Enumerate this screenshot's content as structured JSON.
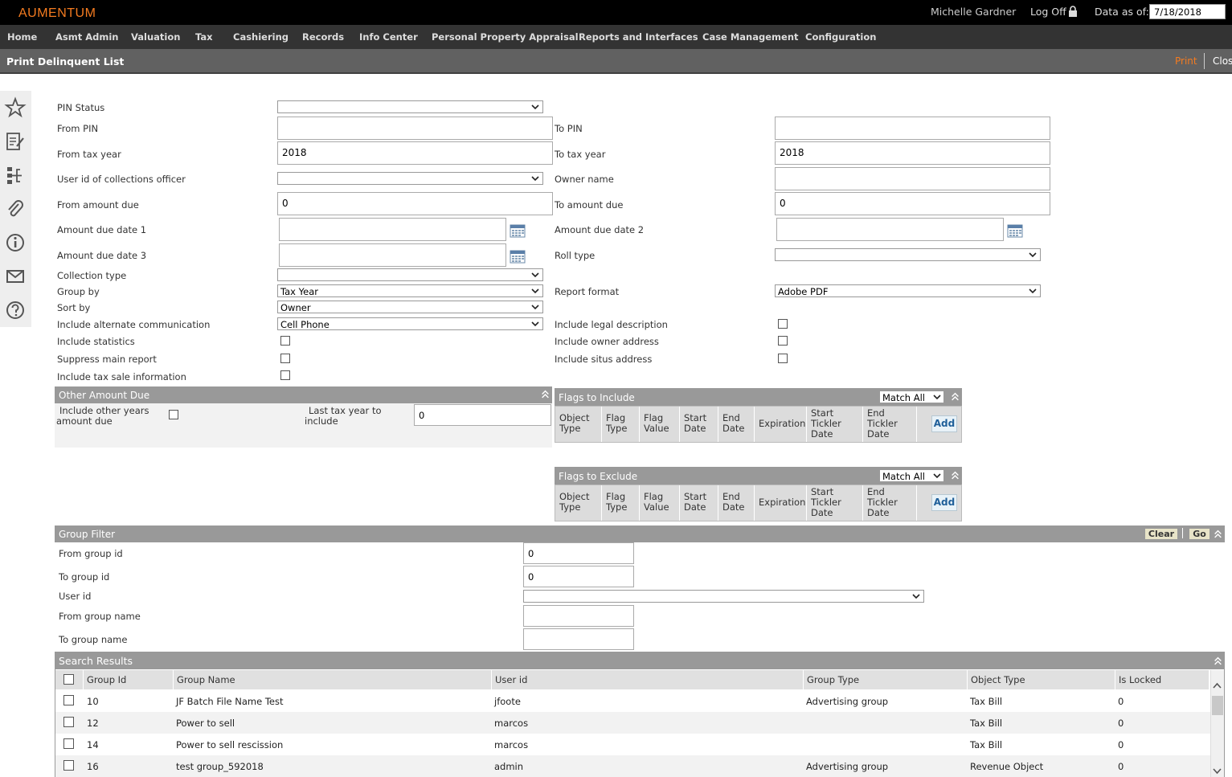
{
  "app": {
    "brand": "AUMENTUM",
    "user": "Michelle Gardner",
    "logoff": "Log Off",
    "data_as_of_label": "Data as of:",
    "data_as_of_value": "7/18/2018"
  },
  "nav": [
    "Home",
    "Asmt Admin",
    "Valuation",
    "Tax",
    "Cashiering",
    "Records",
    "Info Center",
    "Personal Property Appraisal",
    "Reports and Interfaces",
    "Case Management",
    "Configuration"
  ],
  "page": {
    "title": "Print Delinquent List",
    "print": "Print",
    "close": "Clos"
  },
  "form": {
    "pin_status": {
      "label": "PIN Status",
      "value": ""
    },
    "from_pin": {
      "label": "From PIN",
      "value": ""
    },
    "to_pin": {
      "label": "To PIN",
      "value": ""
    },
    "from_tax_year": {
      "label": "From tax year",
      "value": "2018"
    },
    "to_tax_year": {
      "label": "To tax year",
      "value": "2018"
    },
    "collections_officer": {
      "label": "User id of collections officer",
      "value": ""
    },
    "owner_name": {
      "label": "Owner name",
      "value": ""
    },
    "from_amount_due": {
      "label": "From amount due",
      "value": "0"
    },
    "to_amount_due": {
      "label": "To amount due",
      "value": "0"
    },
    "amount_due_date1": {
      "label": "Amount due date 1",
      "value": ""
    },
    "amount_due_date2": {
      "label": "Amount due date 2",
      "value": ""
    },
    "amount_due_date3": {
      "label": "Amount due date 3",
      "value": ""
    },
    "roll_type": {
      "label": "Roll type",
      "value": ""
    },
    "collection_type": {
      "label": "Collection type",
      "value": ""
    },
    "group_by": {
      "label": "Group by",
      "value": "Tax Year"
    },
    "report_format": {
      "label": "Report format",
      "value": "Adobe PDF"
    },
    "sort_by": {
      "label": "Sort by",
      "value": "Owner"
    },
    "alt_comm": {
      "label": "Include alternate communication",
      "value": "Cell Phone"
    },
    "legal_desc": {
      "label": "Include legal description"
    },
    "statistics": {
      "label": "Include statistics"
    },
    "owner_address": {
      "label": "Include owner address"
    },
    "suppress_main": {
      "label": "Suppress main report"
    },
    "situs_address": {
      "label": "Include situs address"
    },
    "tax_sale": {
      "label": "Include tax sale information"
    }
  },
  "other_amount": {
    "title": "Other Amount Due",
    "other_years_label_1": "Include other years",
    "other_years_label_2": "amount due",
    "last_tax_year_label_1": "Last tax year to",
    "last_tax_year_label_2": "include",
    "last_tax_year_value": "0"
  },
  "flags_include": {
    "title": "Flags to Include",
    "match": "Match All",
    "add": "Add"
  },
  "flags_exclude": {
    "title": "Flags to Exclude",
    "match": "Match All",
    "add": "Add"
  },
  "flag_columns": [
    [
      "Object",
      "Type"
    ],
    [
      "Flag",
      "Type"
    ],
    [
      "Flag",
      "Value"
    ],
    [
      "Start",
      "Date"
    ],
    [
      "End",
      "Date"
    ],
    [
      "Expiration"
    ],
    [
      "Start",
      "Tickler",
      "Date"
    ],
    [
      "End",
      "Tickler",
      "Date"
    ]
  ],
  "group_filter": {
    "title": "Group Filter",
    "clear": "Clear",
    "go": "Go",
    "from_group_id": {
      "label": "From group id",
      "value": "0"
    },
    "to_group_id": {
      "label": "To group id",
      "value": "0"
    },
    "user_id": {
      "label": "User id",
      "value": ""
    },
    "from_group_name": {
      "label": "From group name",
      "value": ""
    },
    "to_group_name": {
      "label": "To group name",
      "value": ""
    }
  },
  "search_results": {
    "title": "Search Results",
    "columns": [
      "Group Id",
      "Group Name",
      "User id",
      "Group Type",
      "Object Type",
      "Is Locked"
    ],
    "rows": [
      [
        "10",
        "JF Batch File Name Test",
        "jfoote",
        "Advertising group",
        "Tax Bill",
        "0"
      ],
      [
        "12",
        "Power to sell",
        "marcos",
        "",
        "Tax Bill",
        "0"
      ],
      [
        "14",
        "Power to sell rescission",
        "marcos",
        "",
        "Tax Bill",
        "0"
      ],
      [
        "16",
        "test group_592018",
        "admin",
        "Advertising group",
        "Revenue Object",
        "0"
      ]
    ]
  },
  "colors": {
    "brand": "#f47b20",
    "topbar": "#000000",
    "navbar": "#333333",
    "titlebar": "#616161",
    "panel": "#999999"
  },
  "icons": [
    "star-icon",
    "edit-note-icon",
    "hierarchy-icon",
    "paperclip-icon",
    "info-icon",
    "mail-icon",
    "help-icon",
    "calendar-icon",
    "chevron-down-icon",
    "collapse-up-icon",
    "lock-icon"
  ]
}
